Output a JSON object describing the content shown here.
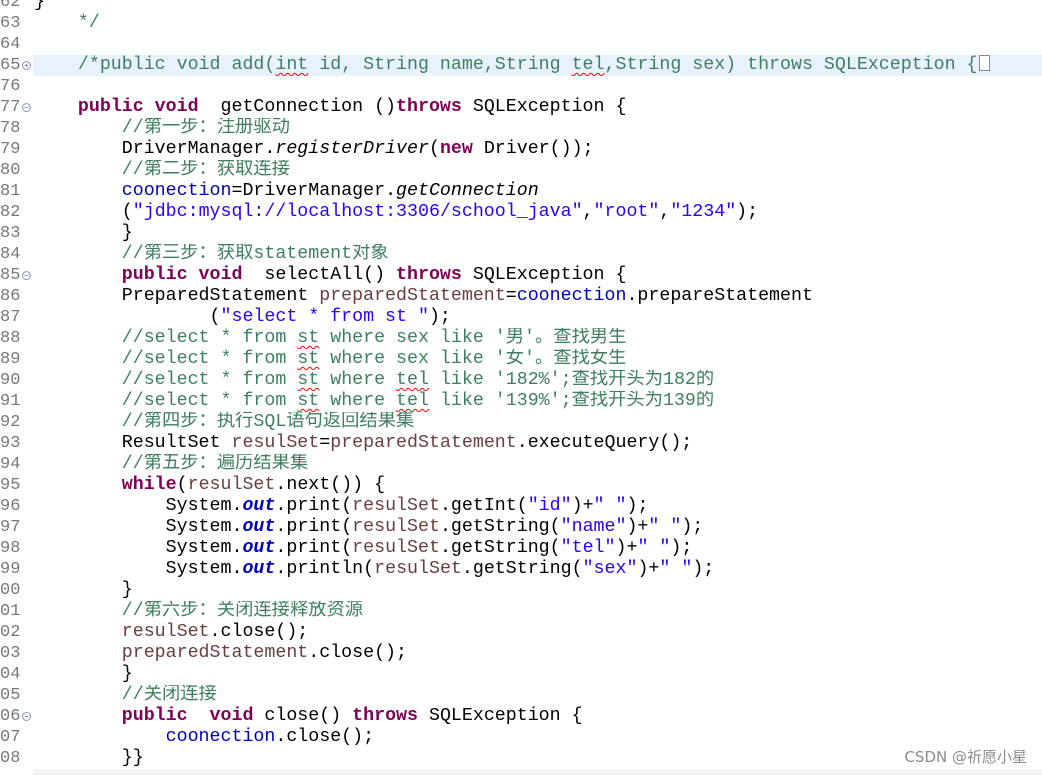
{
  "editor": {
    "syntax_colors": {
      "plain": "#000000",
      "keyword": "#7f0055",
      "comment": "#3f7f5f",
      "string": "#2a00ff",
      "field": "#0000c0",
      "local": "#6a3e3e",
      "static_method": "#000000",
      "static_field": "#0000c0",
      "line_number": "#787878",
      "current_line": "#e8f2fe",
      "misspelling": "#ff0000",
      "fold_marker": "#7b8ba8",
      "fold_box": "#8a8a8a",
      "watermark": "#8c8c8c"
    },
    "lines": [
      {
        "num": "62",
        "tokens": [
          {
            "plain": "}"
          }
        ]
      },
      {
        "num": "63",
        "tokens": [
          {
            "comment": "    */"
          }
        ]
      },
      {
        "num": "64",
        "tokens": []
      },
      {
        "num": "65",
        "fold_icon": "fold-expand-icon",
        "folded": true,
        "current": true,
        "tokens": [
          {
            "comment": "    /*public void add("
          },
          {
            "comment": "int",
            "misspelled": true
          },
          {
            "comment": " id, String name,String "
          },
          {
            "comment": "tel",
            "misspelled": true
          },
          {
            "comment": ",String sex) throws SQLException {"
          }
        ]
      },
      {
        "num": "76",
        "tokens": []
      },
      {
        "num": "77",
        "fold_icon": "fold-collapse-icon",
        "tokens": [
          {
            "keyword": "    public void"
          },
          {
            "plain": "  getConnection ()"
          },
          {
            "keyword": "throws"
          },
          {
            "plain": " SQLException {"
          }
        ]
      },
      {
        "num": "78",
        "tokens": [
          {
            "comment": "        //第一步：注册驱动"
          }
        ]
      },
      {
        "num": "79",
        "tokens": [
          {
            "plain": "        DriverManager."
          },
          {
            "static_method": "registerDriver"
          },
          {
            "plain": "("
          },
          {
            "keyword": "new"
          },
          {
            "plain": " Driver());"
          }
        ]
      },
      {
        "num": "80",
        "tokens": [
          {
            "comment": "        //第二步：获取连接"
          }
        ]
      },
      {
        "num": "81",
        "tokens": [
          {
            "field": "        coonection"
          },
          {
            "plain": "=DriverManager."
          },
          {
            "static_method": "getConnection"
          }
        ]
      },
      {
        "num": "82",
        "tokens": [
          {
            "plain": "        ("
          },
          {
            "string": "\"jdbc:mysql://localhost:3306/school_java\""
          },
          {
            "plain": ","
          },
          {
            "string": "\"root\""
          },
          {
            "plain": ","
          },
          {
            "string": "\"1234\""
          },
          {
            "plain": ");"
          }
        ]
      },
      {
        "num": "83",
        "tokens": [
          {
            "plain": "        }"
          }
        ]
      },
      {
        "num": "84",
        "tokens": [
          {
            "comment": "        //第三步：获取statement对象"
          }
        ]
      },
      {
        "num": "85",
        "fold_icon": "fold-collapse-icon",
        "tokens": [
          {
            "keyword": "        public void"
          },
          {
            "plain": "  selectAll() "
          },
          {
            "keyword": "throws"
          },
          {
            "plain": " SQLException {"
          }
        ]
      },
      {
        "num": "86",
        "tokens": [
          {
            "plain": "        PreparedStatement "
          },
          {
            "local": "preparedStatement"
          },
          {
            "plain": "="
          },
          {
            "field": "coonection"
          },
          {
            "plain": ".prepareStatement"
          }
        ]
      },
      {
        "num": "87",
        "tokens": [
          {
            "plain": "                ("
          },
          {
            "string": "\"select * from st \""
          },
          {
            "plain": ");"
          }
        ]
      },
      {
        "num": "88",
        "tokens": [
          {
            "comment": "        //select * from "
          },
          {
            "comment": "st",
            "misspelled": true
          },
          {
            "comment": " where sex like '男'。查找男生"
          }
        ]
      },
      {
        "num": "89",
        "tokens": [
          {
            "comment": "        //select * from "
          },
          {
            "comment": "st",
            "misspelled": true
          },
          {
            "comment": " where sex like '女'。查找女生"
          }
        ]
      },
      {
        "num": "90",
        "tokens": [
          {
            "comment": "        //select * from "
          },
          {
            "comment": "st",
            "misspelled": true
          },
          {
            "comment": " where "
          },
          {
            "comment": "tel",
            "misspelled": true
          },
          {
            "comment": " like '182%';查找开头为182的"
          }
        ]
      },
      {
        "num": "91",
        "tokens": [
          {
            "comment": "        //select * from "
          },
          {
            "comment": "st",
            "misspelled": true
          },
          {
            "comment": " where "
          },
          {
            "comment": "tel",
            "misspelled": true
          },
          {
            "comment": " like '139%';查找开头为139的"
          }
        ]
      },
      {
        "num": "92",
        "tokens": [
          {
            "comment": "        //第四步：执行SQL语句返回结果集"
          }
        ]
      },
      {
        "num": "93",
        "tokens": [
          {
            "plain": "        ResultSet "
          },
          {
            "local": "resulSet"
          },
          {
            "plain": "="
          },
          {
            "local": "preparedStatement"
          },
          {
            "plain": ".executeQuery();"
          }
        ]
      },
      {
        "num": "94",
        "tokens": [
          {
            "comment": "        //第五步：遍历结果集"
          }
        ]
      },
      {
        "num": "95",
        "tokens": [
          {
            "keyword": "        while"
          },
          {
            "plain": "("
          },
          {
            "local": "resulSet"
          },
          {
            "plain": ".next()) {"
          }
        ]
      },
      {
        "num": "96",
        "tokens": [
          {
            "plain": "            System."
          },
          {
            "static_field": "out"
          },
          {
            "plain": ".print("
          },
          {
            "local": "resulSet"
          },
          {
            "plain": ".getInt("
          },
          {
            "string": "\"id\""
          },
          {
            "plain": ")+"
          },
          {
            "string": "\" \""
          },
          {
            "plain": ");"
          }
        ]
      },
      {
        "num": "97",
        "tokens": [
          {
            "plain": "            System."
          },
          {
            "static_field": "out"
          },
          {
            "plain": ".print("
          },
          {
            "local": "resulSet"
          },
          {
            "plain": ".getString("
          },
          {
            "string": "\"name\""
          },
          {
            "plain": ")+"
          },
          {
            "string": "\" \""
          },
          {
            "plain": ");"
          }
        ]
      },
      {
        "num": "98",
        "tokens": [
          {
            "plain": "            System."
          },
          {
            "static_field": "out"
          },
          {
            "plain": ".print("
          },
          {
            "local": "resulSet"
          },
          {
            "plain": ".getString("
          },
          {
            "string": "\"tel\""
          },
          {
            "plain": ")+"
          },
          {
            "string": "\" \""
          },
          {
            "plain": ");"
          }
        ]
      },
      {
        "num": "99",
        "tokens": [
          {
            "plain": "            System."
          },
          {
            "static_field": "out"
          },
          {
            "plain": ".println("
          },
          {
            "local": "resulSet"
          },
          {
            "plain": ".getString("
          },
          {
            "string": "\"sex\""
          },
          {
            "plain": ")+"
          },
          {
            "string": "\" \""
          },
          {
            "plain": ");"
          }
        ]
      },
      {
        "num": "00",
        "tokens": [
          {
            "plain": "        }"
          }
        ]
      },
      {
        "num": "01",
        "tokens": [
          {
            "comment": "        //第六步：关闭连接释放资源"
          }
        ]
      },
      {
        "num": "02",
        "tokens": [
          {
            "local": "        resulSet"
          },
          {
            "plain": ".close();"
          }
        ]
      },
      {
        "num": "03",
        "tokens": [
          {
            "local": "        preparedStatement"
          },
          {
            "plain": ".close();"
          }
        ]
      },
      {
        "num": "04",
        "tokens": [
          {
            "plain": "        }"
          }
        ]
      },
      {
        "num": "05",
        "tokens": [
          {
            "comment": "        //关闭连接"
          }
        ]
      },
      {
        "num": "06",
        "fold_icon": "fold-collapse-icon",
        "tokens": [
          {
            "keyword": "        public  void"
          },
          {
            "plain": " close() "
          },
          {
            "keyword": "throws"
          },
          {
            "plain": " SQLException {"
          }
        ]
      },
      {
        "num": "07",
        "tokens": [
          {
            "field": "            coonection"
          },
          {
            "plain": ".close();"
          }
        ]
      },
      {
        "num": "08",
        "tokens": [
          {
            "plain": "        }}"
          }
        ]
      }
    ]
  },
  "watermark_text": "CSDN @祈愿小星"
}
